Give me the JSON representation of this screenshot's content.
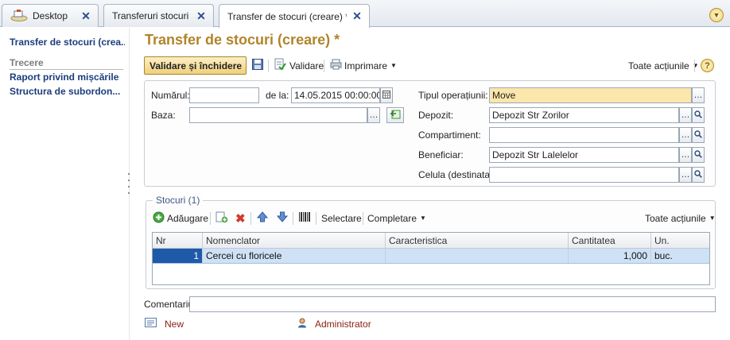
{
  "tabs": [
    {
      "label": "Desktop",
      "icon": "desktop-icon"
    },
    {
      "label": "Transferuri stocuri"
    },
    {
      "label": "Transfer de stocuri (creare) *",
      "active": true
    }
  ],
  "nav": {
    "current": "Transfer de stocuri (crea...",
    "section": "Trecere",
    "links": [
      "Raport privind mișcările",
      "Structura de subordon..."
    ]
  },
  "form": {
    "title": "Transfer de stocuri (creare) *",
    "toolbar": {
      "validate_close": "Validare și închidere",
      "validate": "Validare",
      "print": "Imprimare",
      "all_actions": "Toate acțiunile",
      "help": "?"
    },
    "header": {
      "number_label": "Numărul:",
      "number_value": "",
      "date_label": "de la:",
      "date_value": "14.05.2015 00:00:00",
      "base_label": "Baza:",
      "base_value": "",
      "op_type_label": "Tipul operațiunii:",
      "op_type_value": "Move",
      "warehouse_label": "Depozit:",
      "warehouse_value": "Depozit Str Zorilor",
      "compartment_label": "Compartiment:",
      "compartment_value": "",
      "beneficiary_label": "Beneficiar:",
      "beneficiary_value": "Depozit Str Lalelelor",
      "cell_label": "Celula (destinatar):",
      "cell_value": ""
    },
    "stocks": {
      "title": "Stocuri (1)",
      "toolbar": {
        "add": "Adăugare",
        "select": "Selectare",
        "fill": "Completare",
        "all_actions": "Toate acțiunile"
      },
      "columns": [
        "Nr",
        "Nomenclator",
        "Caracteristica",
        "Cantitatea",
        "Un."
      ],
      "rows": [
        {
          "nr": "1",
          "item": "Cercei cu floricele",
          "characteristic": "",
          "quantity": "1,000",
          "unit": "buc."
        }
      ]
    },
    "comment_label": "Comentariu:",
    "comment_value": "",
    "footer": {
      "status": "New",
      "author": "Administrator"
    }
  },
  "colors": {
    "title": "#b1842a",
    "nav_link": "#1b3d7c",
    "primary_button": "#efd07c",
    "required_field": "#fbe6ab",
    "selected_row": "#cfe1f5",
    "footer_text": "#8b2016"
  }
}
